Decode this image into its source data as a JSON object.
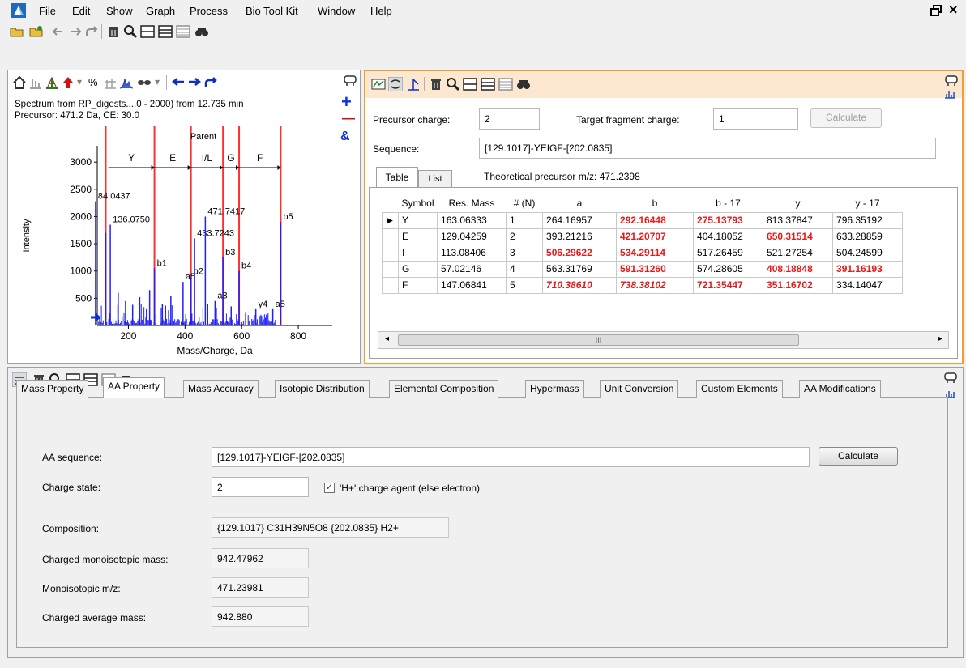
{
  "menubar": {
    "items": [
      "File",
      "Edit",
      "Show",
      "Graph",
      "Process",
      "Bio Tool Kit",
      "Window",
      "Help"
    ],
    "window_controls": [
      "_",
      "×"
    ]
  },
  "spectrum": {
    "info_line1": "Spectrum from RP_digests....0 - 2000) from 12.735 min",
    "info_line2": "Precursor: 471.2 Da, CE: 30.0",
    "percent_icon": "%",
    "ylabel": "Intensity",
    "xlabel": "Mass/Charge, Da",
    "plus": "+",
    "minus": "—",
    "amp": "&"
  },
  "chart_data": {
    "type": "bar",
    "xlabel": "Mass/Charge, Da",
    "ylabel": "Intensity",
    "xlim": [
      90,
      920
    ],
    "ylim": [
      0,
      3300
    ],
    "x_ticks": [
      200,
      400,
      600,
      800
    ],
    "y_ticks": [
      500,
      1000,
      1500,
      2000,
      2500,
      3000
    ],
    "ion_marker_lines_mz": [
      120,
      292,
      421,
      534,
      591,
      738
    ],
    "sequence_segments": [
      {
        "label": "Y",
        "from": 129,
        "to": 292
      },
      {
        "label": "E",
        "from": 292,
        "to": 421
      },
      {
        "label": "I/L",
        "from": 421,
        "to": 534
      },
      {
        "label": "G",
        "from": 534,
        "to": 591
      },
      {
        "label": "F",
        "from": 591,
        "to": 738
      }
    ],
    "parent_label": "Parent",
    "peaks": [
      {
        "mz": 84.0437,
        "intensity": 2280,
        "label": "84.0437"
      },
      {
        "mz": 120.08,
        "intensity": 1700
      },
      {
        "mz": 136.075,
        "intensity": 1850,
        "label": "136.0750"
      },
      {
        "mz": 164,
        "intensity": 600
      },
      {
        "mz": 190,
        "intensity": 450
      },
      {
        "mz": 215,
        "intensity": 380
      },
      {
        "mz": 240,
        "intensity": 520
      },
      {
        "mz": 264,
        "intensity": 300
      },
      {
        "mz": 275,
        "intensity": 650
      },
      {
        "mz": 292,
        "intensity": 1050,
        "label": "b1"
      },
      {
        "mz": 320,
        "intensity": 400
      },
      {
        "mz": 350,
        "intensity": 550
      },
      {
        "mz": 393,
        "intensity": 800,
        "label": "a5"
      },
      {
        "mz": 421,
        "intensity": 900,
        "label": "b2"
      },
      {
        "mz": 433.7243,
        "intensity": 1600,
        "label": "433.7243"
      },
      {
        "mz": 471.7417,
        "intensity": 2000,
        "label": "471.7417"
      },
      {
        "mz": 480,
        "intensity": 400
      },
      {
        "mz": 506,
        "intensity": 450,
        "label": "a3"
      },
      {
        "mz": 534,
        "intensity": 1250,
        "label": "b3"
      },
      {
        "mz": 563,
        "intensity": 350
      },
      {
        "mz": 591,
        "intensity": 1000,
        "label": "b4"
      },
      {
        "mz": 650,
        "intensity": 300,
        "label": "y4"
      },
      {
        "mz": 710,
        "intensity": 300,
        "label": "a5"
      },
      {
        "mz": 738,
        "intensity": 1900,
        "label": "b5"
      }
    ]
  },
  "fragment": {
    "precursor_charge_label": "Precursor charge:",
    "precursor_charge": "2",
    "target_charge_label": "Target fragment charge:",
    "target_charge": "1",
    "calculate": "Calculate",
    "sequence_label": "Sequence:",
    "sequence": "[129.1017]-YEIGF-[202.0835]",
    "tab_table": "Table",
    "tab_list": "List",
    "theoretical": "Theoretical precursor m/z: 471.2398",
    "columns": [
      "Symbol",
      "Res. Mass",
      "# (N)",
      "a",
      "b",
      "b - 17",
      "y",
      "y - 17"
    ],
    "rows": [
      [
        "Y",
        "163.06333",
        "1",
        "264.16957",
        "292.16448",
        "275.13793",
        "813.37847",
        "796.35192"
      ],
      [
        "E",
        "129.04259",
        "2",
        "393.21216",
        "421.20707",
        "404.18052",
        "650.31514",
        "633.28859"
      ],
      [
        "I",
        "113.08406",
        "3",
        "506.29622",
        "534.29114",
        "517.26459",
        "521.27254",
        "504.24599"
      ],
      [
        "G",
        "57.02146",
        "4",
        "563.31769",
        "591.31260",
        "574.28605",
        "408.18848",
        "391.16193"
      ],
      [
        "F",
        "147.06841",
        "5",
        "710.38610",
        "738.38102",
        "721.35447",
        "351.16702",
        "334.14047"
      ]
    ],
    "scroll_marker": "III"
  },
  "calc": {
    "tabs": [
      "Mass Property",
      "AA Property",
      "Mass Accuracy",
      "Isotopic Distribution",
      "Elemental Composition",
      "Hypermass",
      "Unit Conversion",
      "Custom Elements",
      "AA Modifications"
    ],
    "aa_sequence_label": "AA sequence:",
    "aa_sequence": "[129.1017]-YEIGF-[202.0835]",
    "calculate": "Calculate",
    "charge_state_label": "Charge state:",
    "charge_state": "2",
    "charge_agent_label": "'H+' charge agent (else electron)",
    "composition_label": "Composition:",
    "composition": "{129.1017} C31H39N5O8 {202.0835} H2+",
    "charged_mono_label": "Charged monoisotopic mass:",
    "charged_mono": "942.47962",
    "mono_mz_label": "Monoisotopic m/z:",
    "mono_mz": "471.23981",
    "charged_avg_label": "Charged average mass:",
    "charged_avg": "942.880"
  },
  "colors": {
    "accent_orange": "#f0a030",
    "peak_blue": "#2020ff",
    "marker_red": "#ff3030",
    "highlight_red": "#e31b1b"
  }
}
